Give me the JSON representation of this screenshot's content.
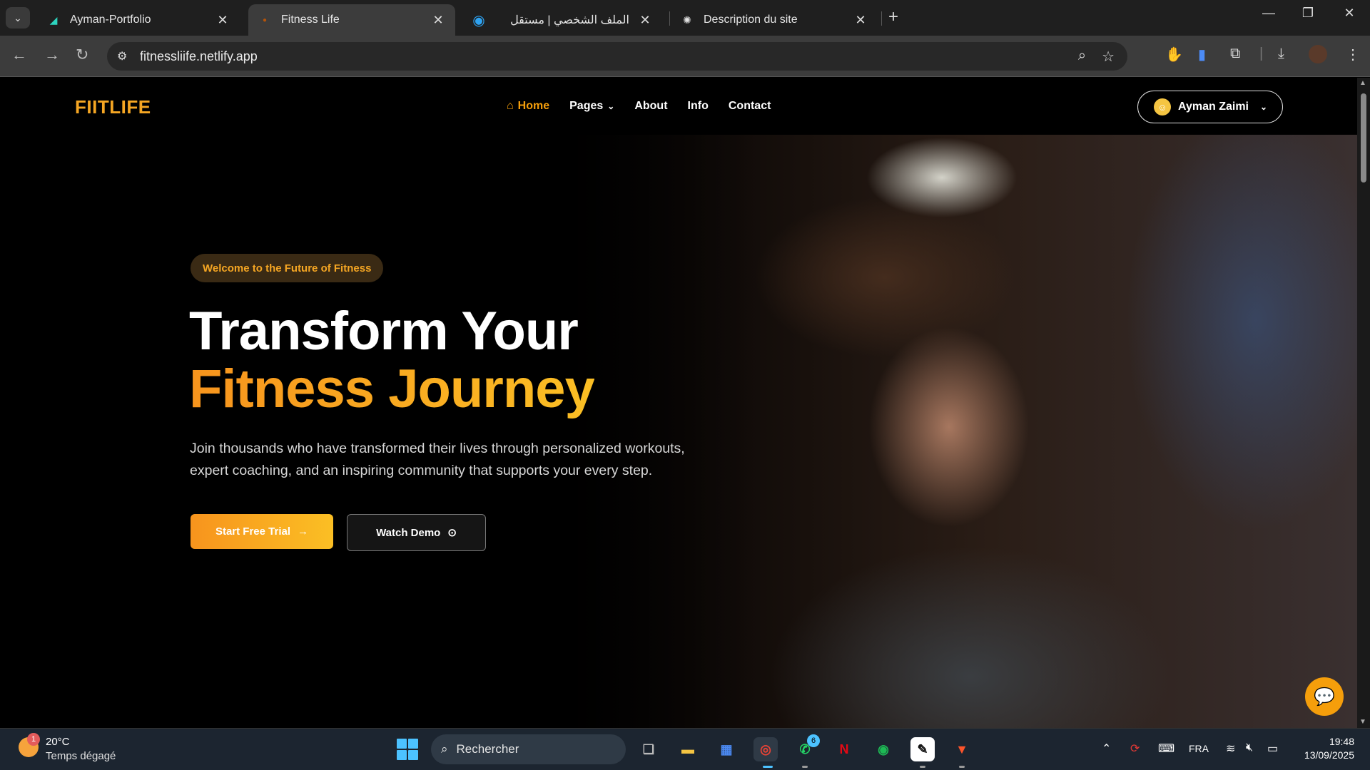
{
  "browser": {
    "tabs": [
      {
        "title": "Ayman-Portfolio",
        "favicon": "vercel-icon"
      },
      {
        "title": "Fitness Life",
        "favicon": "fitness-icon"
      },
      {
        "title": "الملف الشخصي | مستقل",
        "favicon": "mostaql-icon"
      },
      {
        "title": "Description du site",
        "favicon": "chatgpt-icon"
      }
    ],
    "url": "fitnessliife.netlify.app"
  },
  "site": {
    "logo": "FIITLIFE",
    "nav": {
      "home": "Home",
      "pages": "Pages",
      "about": "About",
      "info": "Info",
      "contact": "Contact"
    },
    "user_name": "Ayman Zaimi",
    "accent_color": "#f59e0b"
  },
  "hero": {
    "badge": "Welcome to the Future of Fitness",
    "title_line1": "Transform Your",
    "title_line2": "Fitness Journey",
    "subtitle": "Join thousands who have transformed their lives through personalized workouts, expert coaching, and an inspiring community that supports your every step.",
    "primary_cta": "Start Free Trial",
    "secondary_cta": "Watch Demo"
  },
  "taskbar": {
    "weather_temp": "20°C",
    "weather_desc": "Temps dégagé",
    "weather_badge": "1",
    "search_placeholder": "Rechercher",
    "whatsapp_badge": "6",
    "language": "FRA",
    "time": "19:48",
    "date": "13/09/2025"
  }
}
